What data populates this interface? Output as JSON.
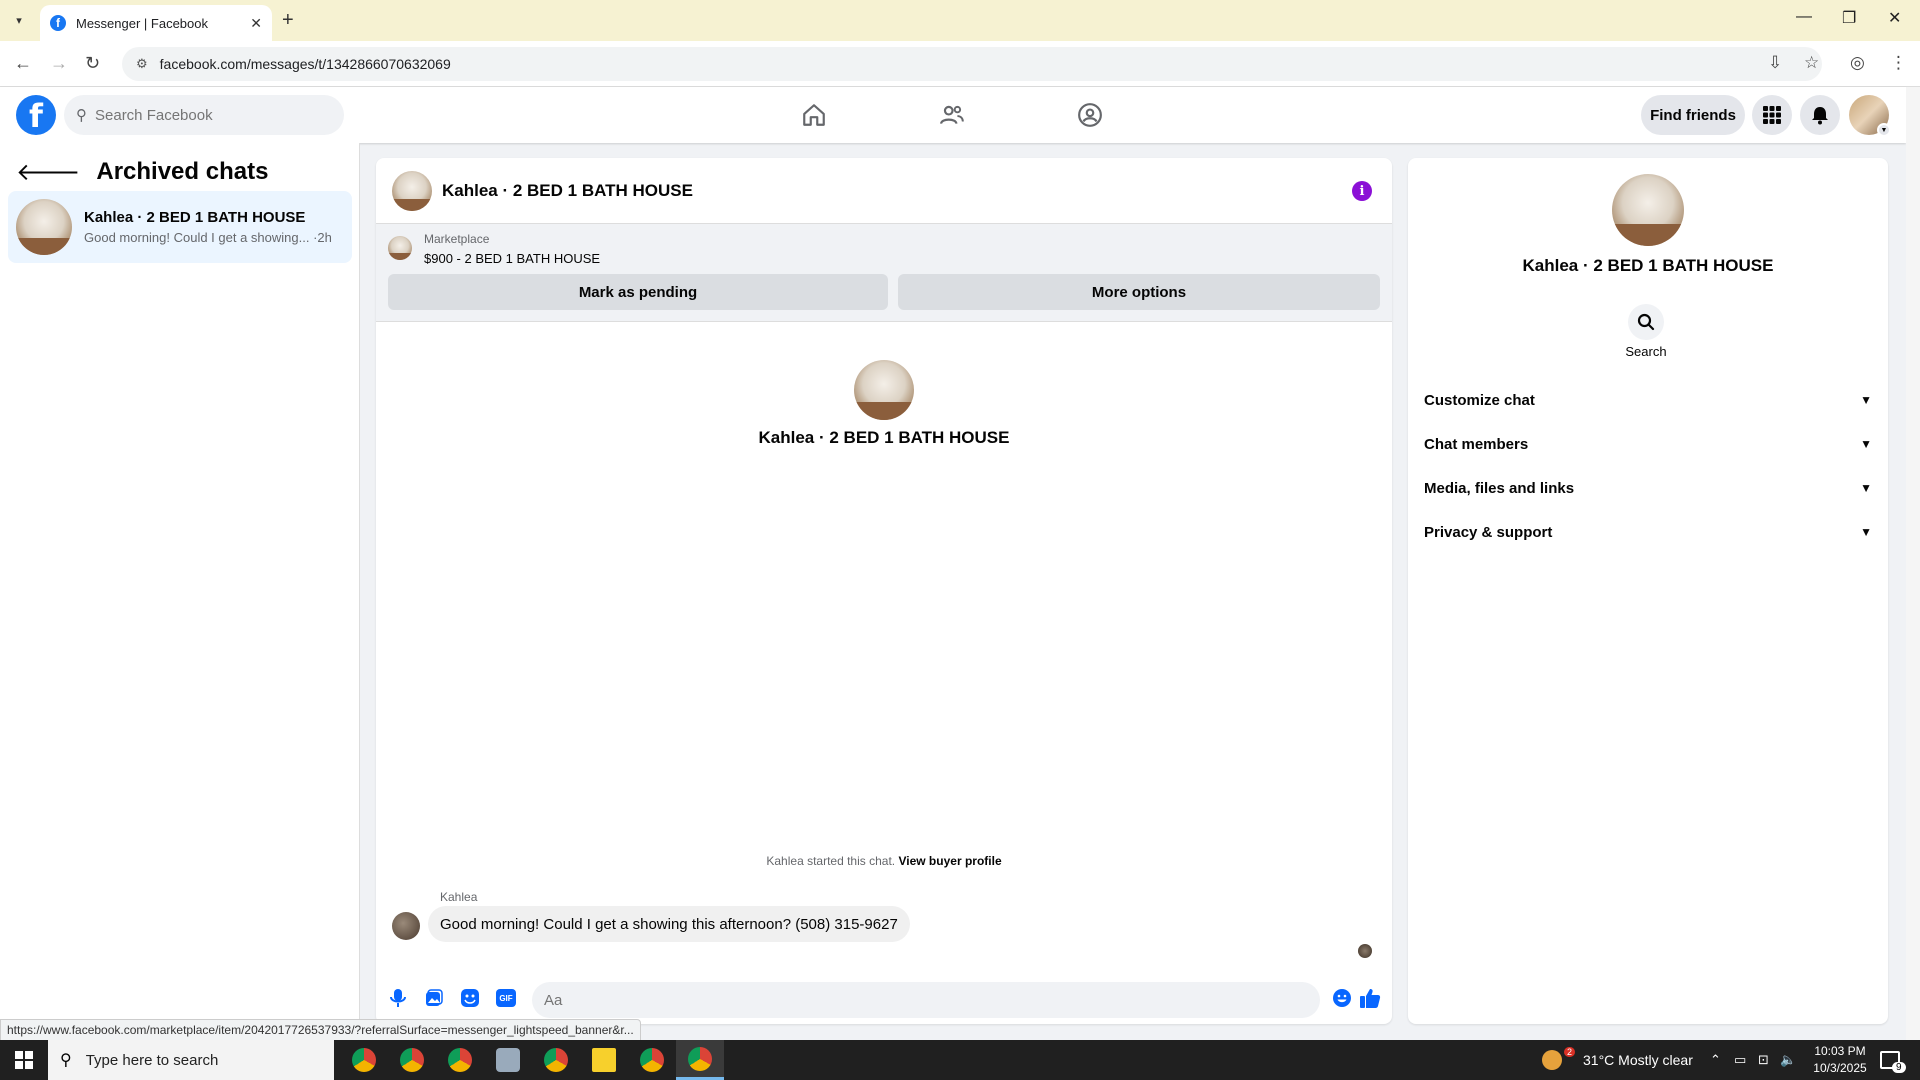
{
  "browser": {
    "tab_title": "Messenger | Facebook",
    "url": "facebook.com/messages/t/1342866070632069",
    "status_url": "https://www.facebook.com/marketplace/item/2042017726537933/?referralSurface=messenger_lightspeed_banner&r..."
  },
  "header": {
    "search_placeholder": "Search Facebook",
    "find_friends": "Find friends"
  },
  "sidebar": {
    "title": "Archived chats",
    "chats": [
      {
        "name": "Kahlea · 2 BED 1 BATH HOUSE",
        "preview": "Good morning! Could I get a showing... ·2h"
      }
    ]
  },
  "chat": {
    "title": "Kahlea · 2 BED 1 BATH HOUSE",
    "marketplace_label": "Marketplace",
    "listing": "$900 - 2 BED 1 BATH HOUSE",
    "mark_pending": "Mark as pending",
    "more_options": "More options",
    "thread_name": "Kahlea · 2 BED 1 BATH HOUSE",
    "started_text": "Kahlea started this chat.",
    "view_buyer": "View buyer profile",
    "sender": "Kahlea",
    "message": "Good morning! Could I get a showing this afternoon? (508) 315-9627",
    "input_placeholder": "Aa"
  },
  "details": {
    "name": "Kahlea · 2 BED 1 BATH HOUSE",
    "search_label": "Search",
    "sections": [
      "Customize chat",
      "Chat members",
      "Media, files and links",
      "Privacy & support"
    ]
  },
  "taskbar": {
    "search_placeholder": "Type here to search",
    "weather": "31°C  Mostly clear",
    "weather_badge": "2",
    "time": "10:03 PM",
    "date": "10/3/2025",
    "notifications": "9"
  },
  "colors": {
    "fb_blue": "#1877f2",
    "messenger_blue": "#0866ff",
    "info_purple": "#8b10d6",
    "selected_chat": "#ebf5ff"
  }
}
